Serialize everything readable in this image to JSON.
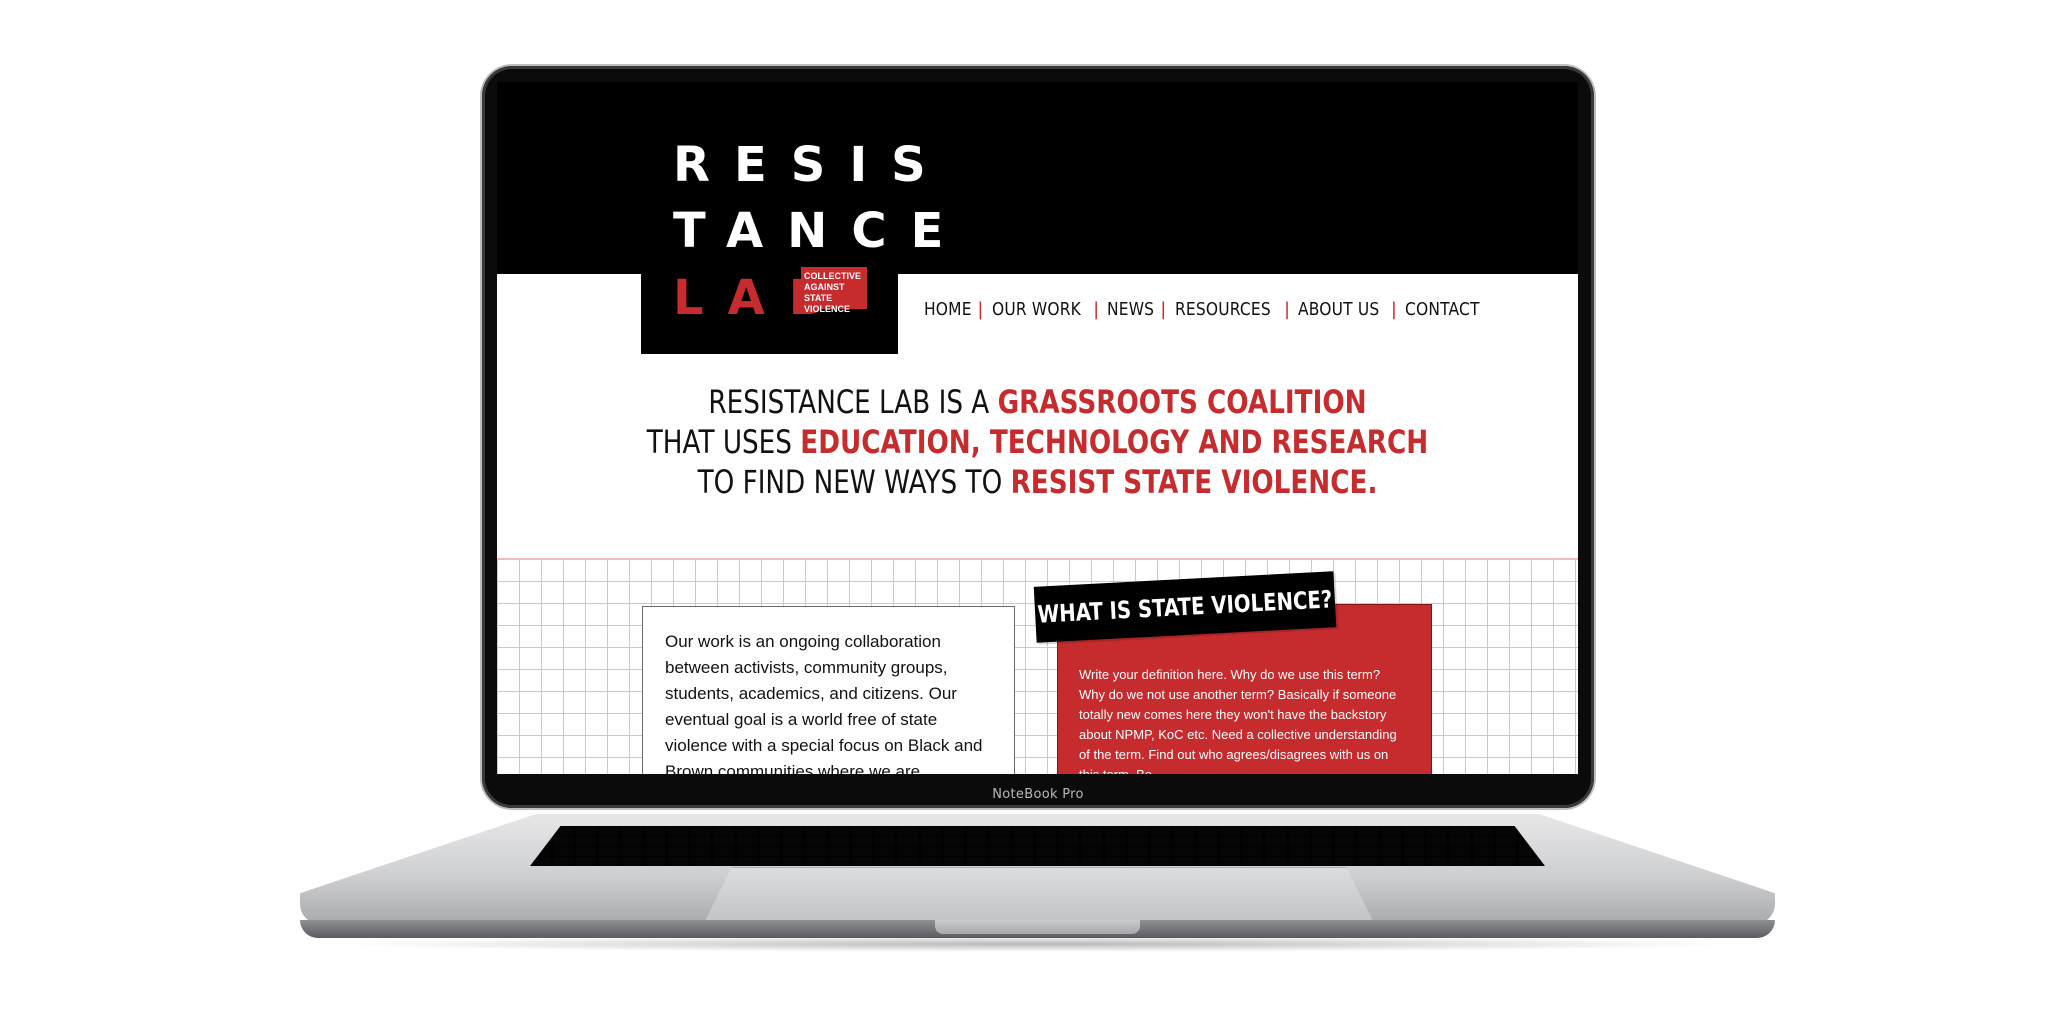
{
  "device": {
    "label": "NoteBook Pro"
  },
  "site": {
    "logo": {
      "line1": "RESIS",
      "line2": "TANCE",
      "line3": "LAB",
      "tagline": "COLLECTIVE AGAINST STATE VIOLENCE"
    },
    "nav": [
      "HOME",
      "OUR WORK",
      "NEWS",
      "RESOURCES",
      "ABOUT US",
      "CONTACT"
    ],
    "hero": {
      "r1a": "RESISTANCE LAB IS A ",
      "r1b": "GRASSROOTS COALITION",
      "r2a": "THAT USES ",
      "r2b": "EDUCATION, TECHNOLOGY AND RESEARCH",
      "r3a": "TO FIND NEW WAYS TO ",
      "r3b": "RESIST STATE VIOLENCE."
    },
    "about_text": "Our work is an ongoing collaboration between activists, community groups, students, academics, and citizens. Our eventual goal is a world free of state violence with a special focus on Black and Brown communities where we are",
    "violence": {
      "heading": "WHAT IS STATE VIOLENCE?",
      "body": "Write your definition here. Why do we use this term? Why do we not use another term? Basically if someone totally new comes here they won't have the backstory about NPMP, KoC etc. Need a collective understanding of the term. Find out who agrees/disagrees with us on this term. Be"
    }
  },
  "colors": {
    "accent": "#c62b2d",
    "dark": "#000000",
    "grid": "#f0b9bb"
  }
}
